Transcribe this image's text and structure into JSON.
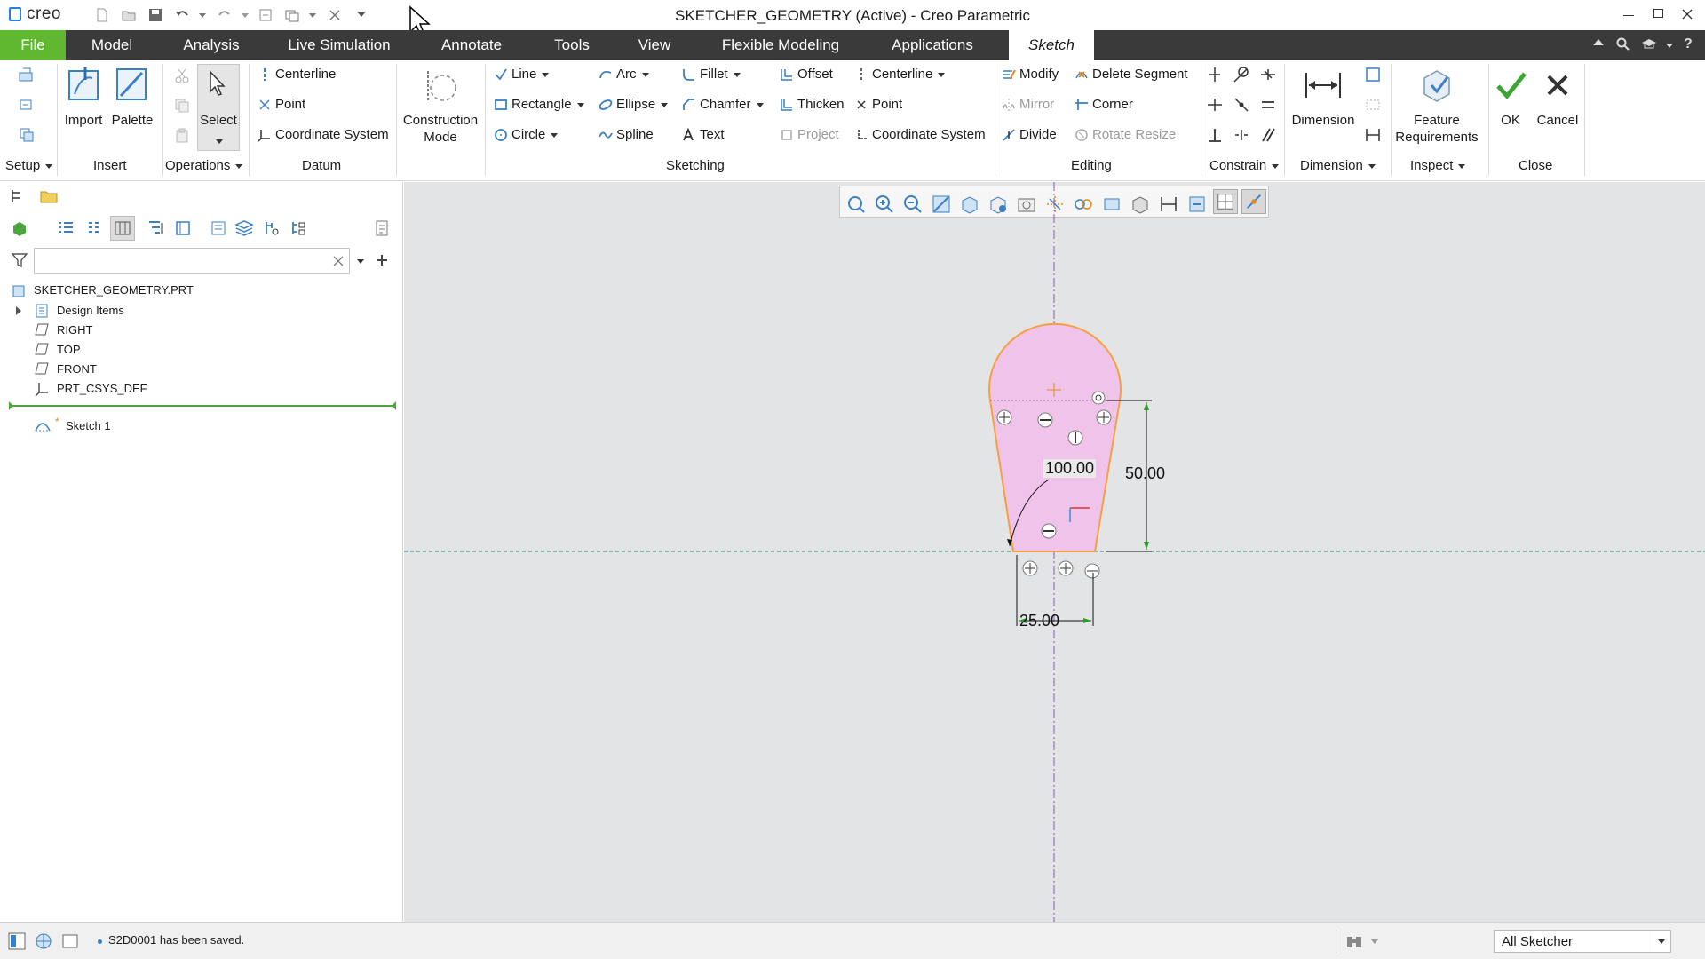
{
  "window": {
    "app_logo": "creo",
    "title": "SKETCHER_GEOMETRY (Active) - Creo Parametric"
  },
  "menubar": {
    "tabs": [
      {
        "label": "File"
      },
      {
        "label": "Model"
      },
      {
        "label": "Analysis"
      },
      {
        "label": "Live Simulation"
      },
      {
        "label": "Annotate"
      },
      {
        "label": "Tools"
      },
      {
        "label": "View"
      },
      {
        "label": "Flexible Modeling"
      },
      {
        "label": "Applications"
      },
      {
        "label": "Sketch"
      }
    ],
    "active_tab": "Sketch"
  },
  "ribbon": {
    "setup": {
      "label": "Setup"
    },
    "insert": {
      "label": "Insert",
      "import": "Import",
      "palette": "Palette"
    },
    "operations": {
      "label": "Operations",
      "select": "Select"
    },
    "datum": {
      "label": "Datum",
      "centerline": "Centerline",
      "point": "Point",
      "coordinate_system": "Coordinate System"
    },
    "construction_mode": {
      "line1": "Construction",
      "line2": "Mode"
    },
    "sketching": {
      "label": "Sketching",
      "line": "Line",
      "rectangle": "Rectangle",
      "circle": "Circle",
      "arc": "Arc",
      "ellipse": "Ellipse",
      "spline": "Spline",
      "fillet": "Fillet",
      "chamfer": "Chamfer",
      "text": "Text",
      "offset": "Offset",
      "thicken": "Thicken",
      "project": "Project",
      "centerline": "Centerline",
      "point": "Point",
      "coordinate_system": "Coordinate System"
    },
    "editing": {
      "label": "Editing",
      "modify": "Modify",
      "mirror": "Mirror",
      "divide": "Divide",
      "delete_segment": "Delete Segment",
      "corner": "Corner",
      "rotate_resize": "Rotate Resize"
    },
    "constrain": {
      "label": "Constrain"
    },
    "dimension": {
      "label": "Dimension",
      "button": "Dimension"
    },
    "inspect": {
      "label": "Inspect",
      "feature_req_line1": "Feature",
      "feature_req_line2": "Requirements"
    },
    "close": {
      "label": "Close",
      "ok": "OK",
      "cancel": "Cancel"
    }
  },
  "model_tree": {
    "search_placeholder": "",
    "root": "SKETCHER_GEOMETRY.PRT",
    "items": [
      {
        "label": "Design Items",
        "icon": "design-items-icon"
      },
      {
        "label": "RIGHT",
        "icon": "datum-plane-icon"
      },
      {
        "label": "TOP",
        "icon": "datum-plane-icon"
      },
      {
        "label": "FRONT",
        "icon": "datum-plane-icon"
      },
      {
        "label": "PRT_CSYS_DEF",
        "icon": "csys-icon"
      }
    ],
    "sketch_item": "Sketch 1",
    "sketch_marker": "*"
  },
  "sketch": {
    "dimensions": {
      "arc_radius": "100.00",
      "height": "50.00",
      "half_width": "25.00"
    },
    "fill_color": "#f0c4ea",
    "outline_color": "#f5a040"
  },
  "status": {
    "message": "S2D0001 has been saved.",
    "filter_value": "All Sketcher"
  },
  "colors": {
    "file_tab": "#5fb830",
    "menubar_bg": "#3a3a3a",
    "canvas_bg": "#e3e4e6"
  }
}
